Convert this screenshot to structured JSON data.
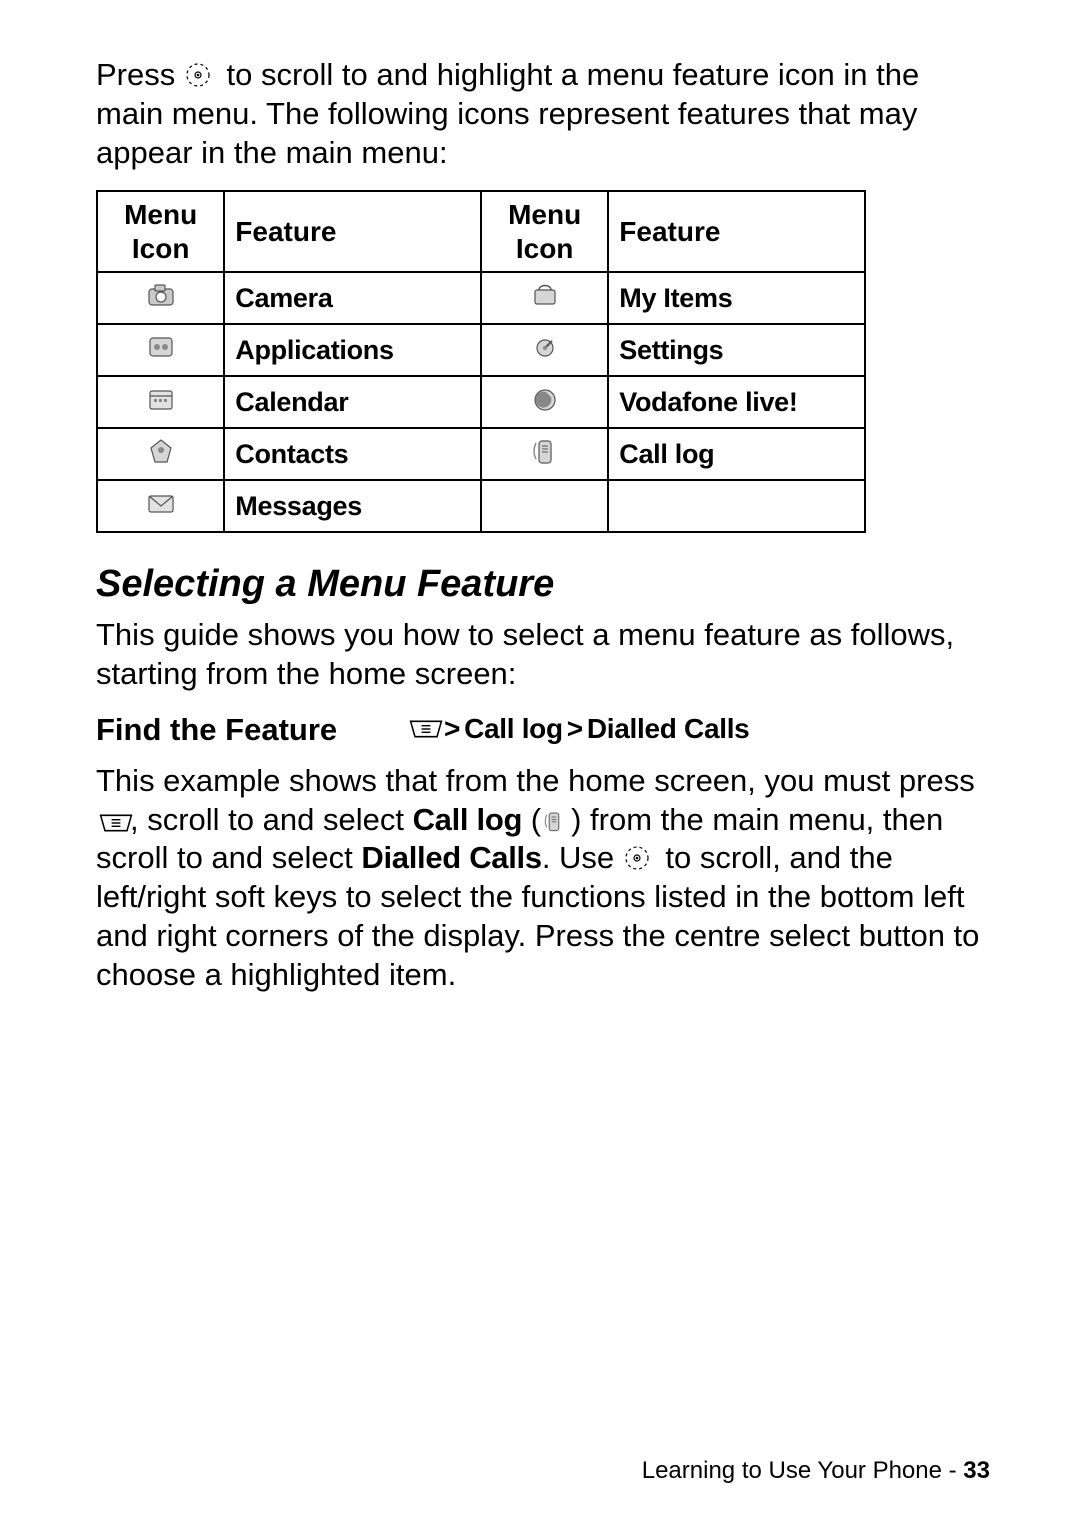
{
  "intro": {
    "prefix": "Press ",
    "suffix": " to scroll to and highlight a menu feature icon in the main menu. The following icons represent features that may appear in the main menu:"
  },
  "table": {
    "headers": {
      "icon1_line1": "Menu",
      "icon1_line2": "Icon",
      "feat1": "Feature",
      "icon2_line1": "Menu",
      "icon2_line2": "Icon",
      "feat2": "Feature"
    },
    "rows": [
      {
        "left_icon_name": "camera-icon",
        "left_feature": "Camera",
        "right_icon_name": "my-items-icon",
        "right_feature": "My Items"
      },
      {
        "left_icon_name": "applications-icon",
        "left_feature": "Applications",
        "right_icon_name": "settings-icon",
        "right_feature": "Settings"
      },
      {
        "left_icon_name": "calendar-icon",
        "left_feature": "Calendar",
        "right_icon_name": "vodafone-live-icon",
        "right_feature": "Vodafone live!"
      },
      {
        "left_icon_name": "contacts-icon",
        "left_feature": "Contacts",
        "right_icon_name": "call-log-icon",
        "right_feature": "Call log"
      },
      {
        "left_icon_name": "messages-icon",
        "left_feature": "Messages",
        "right_icon_name": "",
        "right_feature": ""
      }
    ]
  },
  "section_heading": "Selecting a Menu Feature",
  "section_intro": "This guide shows you how to select a menu feature as follows, starting from the home screen:",
  "find_feature": {
    "label": "Find the Feature",
    "gt1": ">",
    "part1": "Call log",
    "gt2": ">",
    "part2": "Dialled Calls"
  },
  "example": {
    "t1": "This example shows that from the home screen, you must press ",
    "t2": ", scroll to and select ",
    "b1": "Call log",
    "t3": " (",
    "t4": ") from the main menu, then scroll to and select ",
    "b2": "Dialled Calls",
    "t5": ". Use ",
    "t6": " to scroll, and the left/right soft keys to select the functions listed in the bottom left and right corners of the display. Press the centre select button to choose a highlighted item."
  },
  "footer": {
    "text": "Learning to Use Your Phone - ",
    "page": "33"
  }
}
